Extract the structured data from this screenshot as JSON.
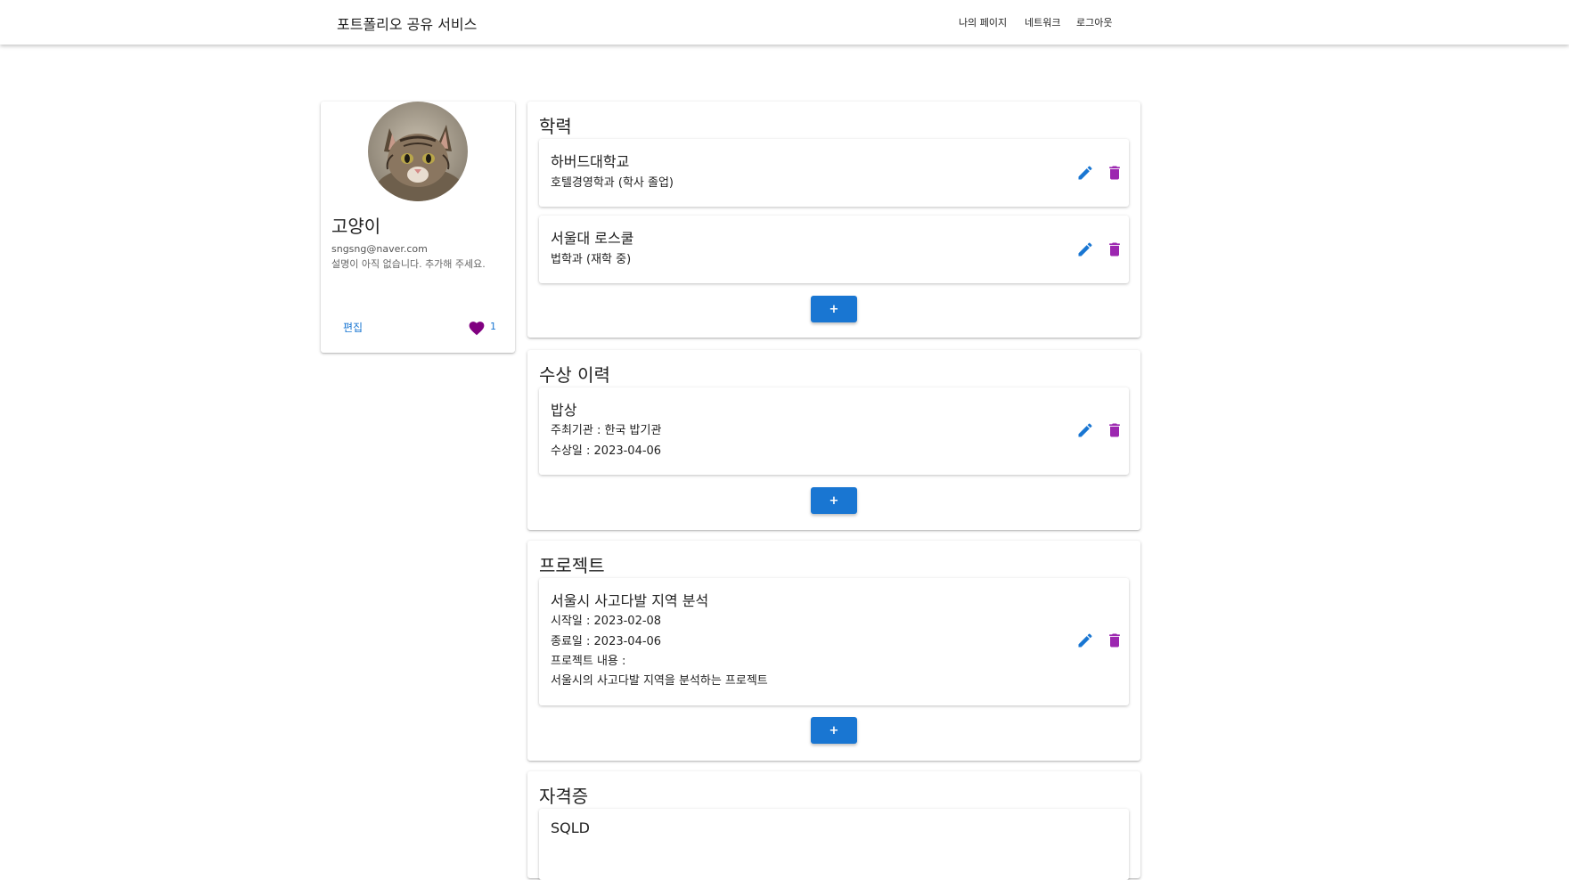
{
  "header": {
    "brand": "포트폴리오 공유 서비스",
    "nav": [
      "나의 페이지",
      "네트워크",
      "로그아웃"
    ]
  },
  "profile": {
    "name": "고양이",
    "email": "sngsng@naver.com",
    "description": "설명이 아직 없습니다. 추가해 주세요.",
    "edit_label": "편집",
    "like_count": "1"
  },
  "education": {
    "title": "학력",
    "items": [
      {
        "school": "하버드대학교",
        "detail": "호텔경영학과 (학사 졸업)"
      },
      {
        "school": "서울대 로스쿨",
        "detail": "법학과 (재학 중)"
      }
    ],
    "add_label": "+"
  },
  "awards": {
    "title": "수상 이력",
    "items": [
      {
        "name": "밥상",
        "org": "주최기관 : 한국 밥기관",
        "date": "수상일 : 2023-04-06"
      }
    ],
    "add_label": "+"
  },
  "projects": {
    "title": "프로젝트",
    "items": [
      {
        "name": "서울시 사고다발 지역 분석",
        "start": "시작일 : 2023-02-08",
        "end": "종료일 : 2023-04-06",
        "content_label": "프로젝트 내용 :",
        "content": "서울시의 사고다발 지역을 분석하는 프로젝트"
      }
    ],
    "add_label": "+"
  },
  "certificates": {
    "title": "자격증",
    "items": [
      {
        "name": "SQLD"
      }
    ]
  },
  "colors": {
    "accent": "#1976d2",
    "delete": "#9c27b0",
    "heart": "#800080"
  }
}
